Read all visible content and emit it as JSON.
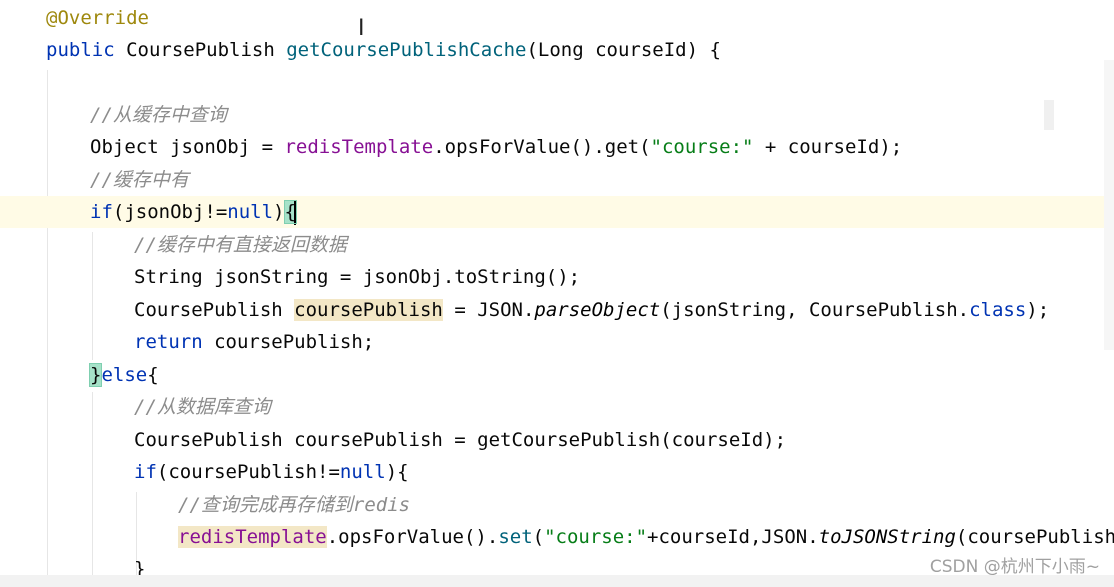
{
  "editor": {
    "lines": [
      {
        "id": "l1",
        "parts": [
          {
            "c": "ann",
            "t": "@Override"
          }
        ]
      },
      {
        "id": "l2",
        "parts": [
          {
            "c": "kw",
            "t": "public "
          },
          {
            "c": "plain",
            "t": "CoursePublish "
          },
          {
            "c": "method",
            "t": "getCoursePublishCache"
          },
          {
            "c": "plain",
            "t": "(Long courseId) {"
          }
        ]
      },
      {
        "id": "l3",
        "parts": []
      },
      {
        "id": "l4",
        "parts": [
          {
            "c": "cmt2",
            "t": "//"
          },
          {
            "c": "cmt",
            "t": "从缓存中查询"
          }
        ]
      },
      {
        "id": "l5",
        "parts": [
          {
            "c": "plain",
            "t": "Object jsonObj = "
          },
          {
            "c": "field",
            "t": "redisTemplate"
          },
          {
            "c": "plain",
            "t": ".opsForValue().get("
          },
          {
            "c": "str",
            "t": "\"course:\""
          },
          {
            "c": "plain",
            "t": " + courseId);"
          }
        ]
      },
      {
        "id": "l6",
        "parts": [
          {
            "c": "cmt2",
            "t": "//"
          },
          {
            "c": "cmt",
            "t": "缓存中有"
          }
        ]
      },
      {
        "id": "l7",
        "parts": [
          {
            "c": "kw",
            "t": "if"
          },
          {
            "c": "plain",
            "t": "(jsonObj!="
          },
          {
            "c": "kw",
            "t": "null"
          },
          {
            "c": "plain",
            "t": ")"
          },
          {
            "c": "brace",
            "t": "{"
          }
        ]
      },
      {
        "id": "l8",
        "parts": [
          {
            "c": "cmt2",
            "t": "//"
          },
          {
            "c": "cmt",
            "t": "缓存中有直接返回数据"
          }
        ]
      },
      {
        "id": "l9",
        "parts": [
          {
            "c": "plain",
            "t": "String jsonString = jsonObj.toString();"
          }
        ]
      },
      {
        "id": "l10",
        "parts": [
          {
            "c": "plain",
            "t": "CoursePublish "
          },
          {
            "c": "mark",
            "t": "coursePublish"
          },
          {
            "c": "plain",
            "t": " = JSON."
          },
          {
            "c": "ital",
            "t": "parseObject"
          },
          {
            "c": "plain",
            "t": "(jsonString, CoursePublish."
          },
          {
            "c": "kw",
            "t": "class"
          },
          {
            "c": "plain",
            "t": ");"
          }
        ]
      },
      {
        "id": "l11",
        "parts": [
          {
            "c": "kw",
            "t": "return "
          },
          {
            "c": "plain",
            "t": "coursePublish;"
          }
        ]
      },
      {
        "id": "l12",
        "parts": [
          {
            "c": "brace2",
            "t": "}"
          },
          {
            "c": "kw",
            "t": "else"
          },
          {
            "c": "plain",
            "t": "{"
          }
        ]
      },
      {
        "id": "l13",
        "parts": [
          {
            "c": "cmt2",
            "t": "//"
          },
          {
            "c": "cmt",
            "t": "从数据库查询"
          }
        ]
      },
      {
        "id": "l14",
        "parts": [
          {
            "c": "plain",
            "t": "CoursePublish coursePublish = getCoursePublish(courseId);"
          }
        ]
      },
      {
        "id": "l15",
        "parts": [
          {
            "c": "kw",
            "t": "if"
          },
          {
            "c": "plain",
            "t": "(coursePublish!="
          },
          {
            "c": "kw",
            "t": "null"
          },
          {
            "c": "plain",
            "t": "){"
          }
        ]
      },
      {
        "id": "l16",
        "parts": [
          {
            "c": "cmt2",
            "t": "//"
          },
          {
            "c": "cmt",
            "t": "查询完成再存储到"
          },
          {
            "c": "cmt2",
            "t": "redis"
          }
        ]
      },
      {
        "id": "l17",
        "parts": [
          {
            "c": "markfield",
            "t": "redisTemplate"
          },
          {
            "c": "plain",
            "t": ".opsForValue()."
          },
          {
            "c": "method",
            "t": "set"
          },
          {
            "c": "plain",
            "t": "("
          },
          {
            "c": "str",
            "t": "\"course:\""
          },
          {
            "c": "plain",
            "t": "+courseId,JSON."
          },
          {
            "c": "ital",
            "t": "toJSONString"
          },
          {
            "c": "plain",
            "t": "(coursePublish));"
          }
        ]
      },
      {
        "id": "l18",
        "parts": [
          {
            "c": "plain",
            "t": "}"
          }
        ]
      }
    ]
  },
  "watermark": "CSDN @杭州下小雨~"
}
